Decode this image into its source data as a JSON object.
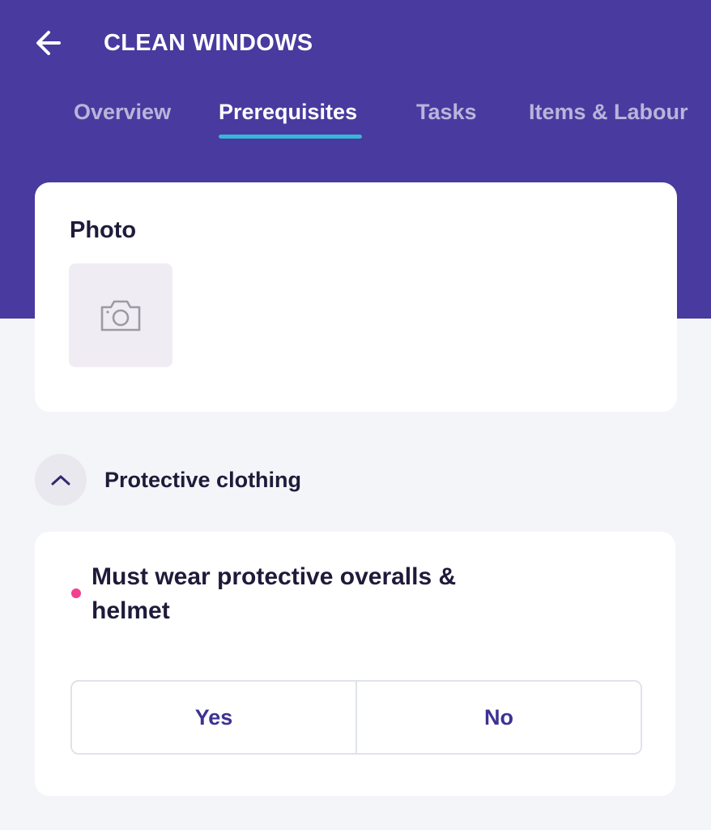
{
  "header": {
    "title": "CLEAN WINDOWS",
    "back_icon": "arrow-left-icon",
    "background_color": "#483a9e",
    "tabs": [
      {
        "label": "Overview",
        "active": false
      },
      {
        "label": "Prerequisites",
        "active": true
      },
      {
        "label": "Tasks",
        "active": false
      },
      {
        "label": "Items & Labour",
        "active": false
      }
    ],
    "active_tab_indicator_color": "#38b6d8"
  },
  "photo_card": {
    "label": "Photo",
    "placeholder_icon": "camera-icon"
  },
  "section": {
    "title": "Protective clothing",
    "toggle_icon": "chevron-up-icon",
    "expanded": true
  },
  "question": {
    "text": "Must wear protective overalls & helmet",
    "required": true,
    "required_color": "#f2418f",
    "options": [
      {
        "label": "Yes"
      },
      {
        "label": "No"
      }
    ]
  }
}
